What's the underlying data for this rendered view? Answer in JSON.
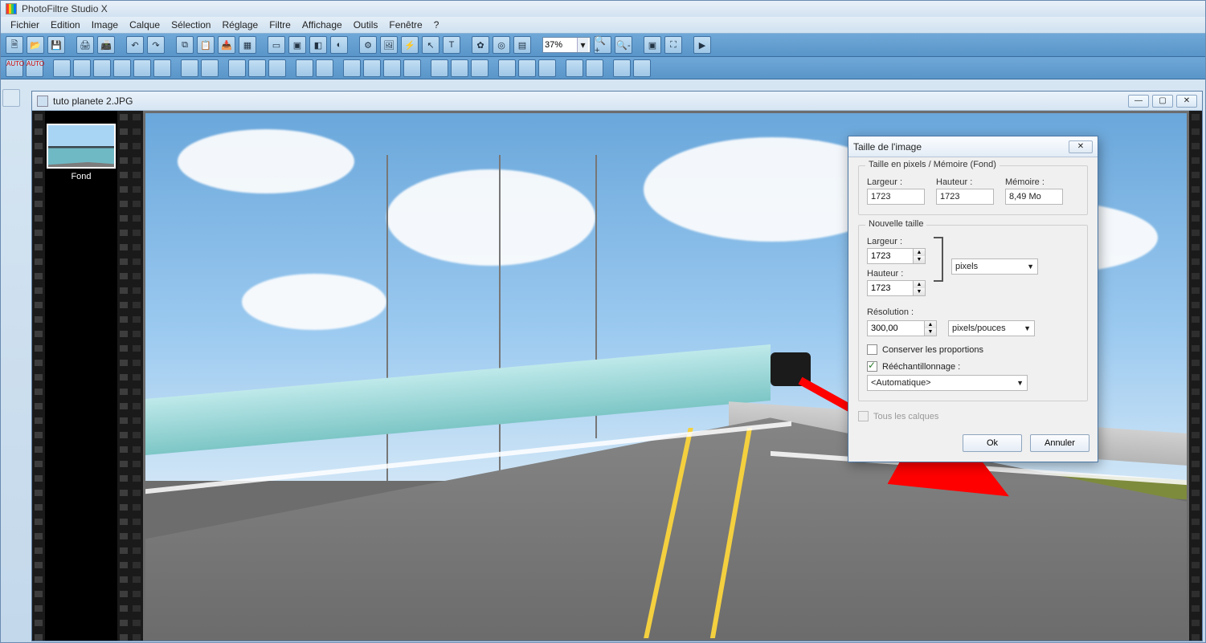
{
  "app": {
    "title": "PhotoFiltre Studio X"
  },
  "menu": {
    "items": [
      "Fichier",
      "Edition",
      "Image",
      "Calque",
      "Sélection",
      "Réglage",
      "Filtre",
      "Affichage",
      "Outils",
      "Fenêtre",
      "?"
    ]
  },
  "toolbar": {
    "zoom_value": "37%"
  },
  "document": {
    "title": "tuto planete 2.JPG",
    "layer_label": "Fond"
  },
  "dialog": {
    "title": "Taille de l'image",
    "group1_label": "Taille en pixels / Mémoire (Fond)",
    "width_label": "Largeur :",
    "height_label": "Hauteur :",
    "memory_label": "Mémoire :",
    "width_ro": "1723",
    "height_ro": "1723",
    "memory_ro": "8,49 Mo",
    "group2_label": "Nouvelle taille",
    "new_width": "1723",
    "new_height": "1723",
    "units": "pixels",
    "resolution_label": "Résolution :",
    "resolution": "300,00",
    "res_units": "pixels/pouces",
    "keep_ratio": "Conserver les proportions",
    "resample": "Rééchantillonnage :",
    "resample_value": "<Automatique>",
    "all_layers": "Tous les calques",
    "ok": "Ok",
    "cancel": "Annuler"
  }
}
